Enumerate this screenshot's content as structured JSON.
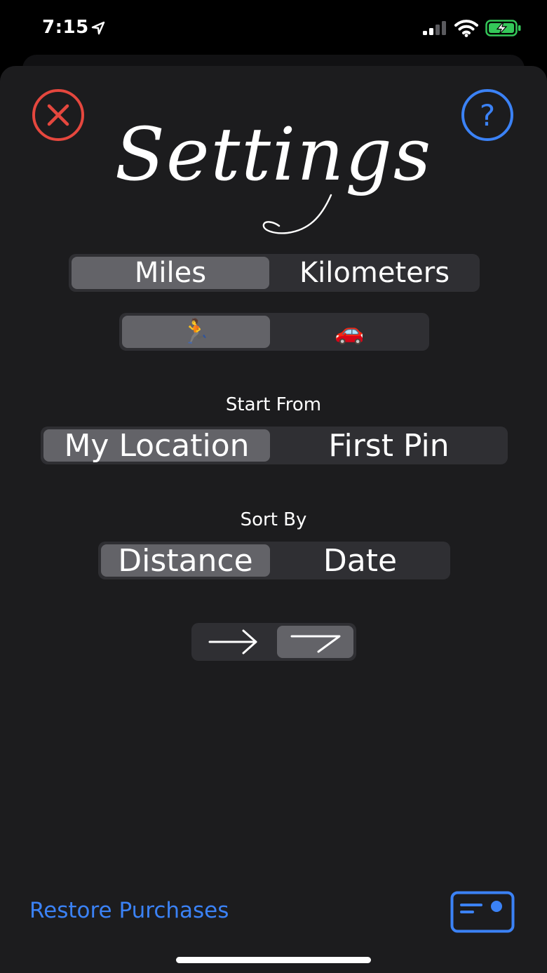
{
  "status_bar": {
    "time": "7:15",
    "icons": [
      "location-arrow-icon",
      "cellular-signal-icon",
      "wifi-icon",
      "battery-charging-icon"
    ]
  },
  "header": {
    "close_icon": "close-circle-icon",
    "help_icon": "question-circle-icon",
    "help_label": "?",
    "title": "Settings"
  },
  "units": {
    "options": [
      "Miles",
      "Kilometers"
    ],
    "selected": "Miles"
  },
  "travel_mode": {
    "options": [
      "🏃",
      "🚗"
    ],
    "selected": "🏃"
  },
  "start_from": {
    "label": "Start From",
    "options": [
      "My Location",
      "First Pin"
    ],
    "selected": "My Location"
  },
  "sort_by": {
    "label": "Sort By",
    "options": [
      "Distance",
      "Date"
    ],
    "selected": "Distance"
  },
  "route_style": {
    "options": [
      "straight-arrow-icon",
      "angled-arrow-icon"
    ],
    "selected": "angled-arrow-icon"
  },
  "footer": {
    "restore_label": "Restore Purchases",
    "card_icon": "card-icon"
  },
  "colors": {
    "accent_blue": "#3b82f6",
    "close_red": "#e5473e",
    "sheet_background": "#1c1c1e",
    "segment_background": "#2f2f33",
    "segment_selected": "#636368"
  }
}
